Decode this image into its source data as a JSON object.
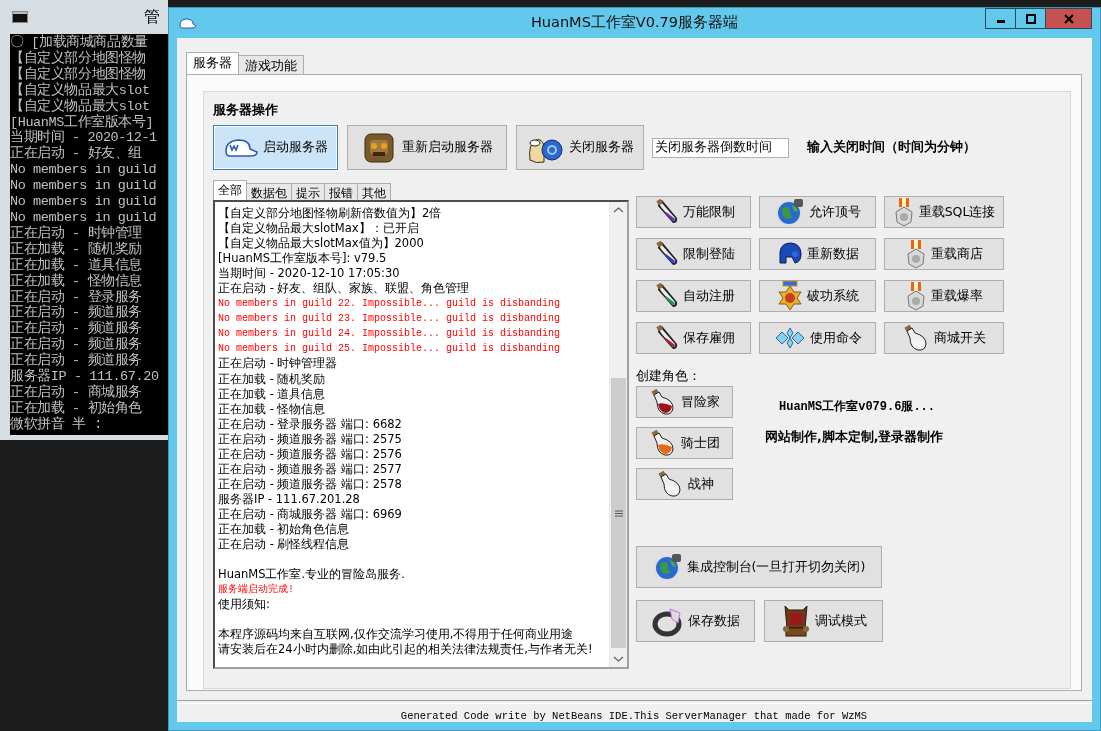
{
  "console": {
    "title": "管",
    "lines": [
      {
        "kind": "text",
        "text": "〇 [加载商城商品数量"
      },
      {
        "kind": "text",
        "text": "【自定义部分地图怪物"
      },
      {
        "kind": "text",
        "text": "【自定义部分地图怪物"
      },
      {
        "kind": "text",
        "text": "【自定义物品最大slot"
      },
      {
        "kind": "text",
        "text": "【自定义物品最大slot"
      },
      {
        "kind": "text",
        "text": "[HuanMS工作室版本号]"
      },
      {
        "kind": "text",
        "text": "当期时间 - 2020-12-1"
      },
      {
        "kind": "text",
        "text": "正在启动 - 好友、组"
      },
      {
        "kind": "text",
        "text": "No members in guild"
      },
      {
        "kind": "text",
        "text": "No members in guild"
      },
      {
        "kind": "text",
        "text": "No members in guild"
      },
      {
        "kind": "text",
        "text": "No members in guild"
      },
      {
        "kind": "text",
        "text": "正在启动 - 时钟管理"
      },
      {
        "kind": "text",
        "text": "正在加载 - 随机奖励"
      },
      {
        "kind": "text",
        "text": "正在加载 - 道具信息"
      },
      {
        "kind": "text",
        "text": "正在加载 - 怪物信息"
      },
      {
        "kind": "text",
        "text": "正在启动 - 登录服务"
      },
      {
        "kind": "text",
        "text": "正在启动 - 频道服务"
      },
      {
        "kind": "text",
        "text": "正在启动 - 频道服务"
      },
      {
        "kind": "text",
        "text": "正在启动 - 频道服务"
      },
      {
        "kind": "text",
        "text": "正在启动 - 频道服务"
      },
      {
        "kind": "text",
        "text": "服务器IP - 111.67.20"
      },
      {
        "kind": "text",
        "text": "正在启动 - 商城服务"
      },
      {
        "kind": "text",
        "text": "正在加载 - 初始角色"
      },
      {
        "kind": "ime",
        "text": "微软拼音 半 :"
      }
    ]
  },
  "window": {
    "title": "HuanMS工作室V0.79服务器端"
  },
  "tabs": [
    {
      "label": "服务器",
      "selected": true
    },
    {
      "label": "游戏功能",
      "selected": false
    }
  ],
  "server_ops": {
    "heading": "服务器操作",
    "buttons": [
      {
        "label": "启动服务器",
        "selected": true
      },
      {
        "label": "重新启动服务器",
        "selected": false
      },
      {
        "label": "关闭服务器",
        "selected": false
      }
    ],
    "countdown_field": {
      "value": "关闭服务器倒数时间"
    },
    "countdown_hint": "输入关闭时间（时间为分钟）"
  },
  "log_tabs": [
    {
      "label": "全部",
      "selected": true
    },
    {
      "label": "数据包",
      "selected": false
    },
    {
      "label": "提示",
      "selected": false
    },
    {
      "label": "报错",
      "selected": false
    },
    {
      "label": "其他",
      "selected": false
    }
  ],
  "log_lines": [
    {
      "kind": "normal",
      "text": "【自定义部分地图怪物刷新倍数值为】2倍"
    },
    {
      "kind": "normal",
      "text": "【自定义物品最大slotMax】：已开启"
    },
    {
      "kind": "normal",
      "text": "【自定义物品最大slotMax值为】2000"
    },
    {
      "kind": "normal",
      "text": "[HuanMS工作室版本号]:  v79.5"
    },
    {
      "kind": "normal",
      "text": "当期时间 - 2020-12-10 17:05:30"
    },
    {
      "kind": "normal",
      "text": "正在启动 - 好友、组队、家族、联盟、角色管理"
    },
    {
      "kind": "error",
      "text": "No members in guild 22.  Impossible... guild is disbanding"
    },
    {
      "kind": "error",
      "text": "No members in guild 23.  Impossible... guild is disbanding"
    },
    {
      "kind": "error",
      "text": "No members in guild 24.  Impossible... guild is disbanding"
    },
    {
      "kind": "error",
      "text": "No members in guild 25.  Impossible... guild is disbanding"
    },
    {
      "kind": "normal",
      "text": "正在启动 - 时钟管理器"
    },
    {
      "kind": "normal",
      "text": "正在加载 - 随机奖励"
    },
    {
      "kind": "normal",
      "text": "正在加载 - 道具信息"
    },
    {
      "kind": "normal",
      "text": "正在加载 - 怪物信息"
    },
    {
      "kind": "normal",
      "text": "正在启动 - 登录服务器 端口: 6682"
    },
    {
      "kind": "normal",
      "text": "正在启动 - 频道服务器 端口: 2575"
    },
    {
      "kind": "normal",
      "text": "正在启动 - 频道服务器 端口: 2576"
    },
    {
      "kind": "normal",
      "text": "正在启动 - 频道服务器 端口: 2577"
    },
    {
      "kind": "normal",
      "text": "正在启动 - 频道服务器 端口: 2578"
    },
    {
      "kind": "normal",
      "text": "服务器IP - 111.67.201.28"
    },
    {
      "kind": "normal",
      "text": "正在启动 - 商城服务器 端口: 6969"
    },
    {
      "kind": "normal",
      "text": "正在加载 - 初始角色信息"
    },
    {
      "kind": "normal",
      "text": "正在启动 - 刷怪线程信息"
    },
    {
      "kind": "gap"
    },
    {
      "kind": "normal",
      "text": "HuanMS工作室.专业的冒险岛服务."
    },
    {
      "kind": "error",
      "text": "服务端启动完成!"
    },
    {
      "kind": "normal",
      "text": "使用须知:"
    },
    {
      "kind": "gap"
    },
    {
      "kind": "normal",
      "text": "本程序源码均来自互联网,仅作交流学习使用,不得用于任何商业用途"
    },
    {
      "kind": "normal",
      "text": "请安装后在24小时内删除,如由此引起的相关法律法规责任,与作者无关!"
    }
  ],
  "function_buttons": [
    "万能限制",
    "允许顶号",
    "重载SQL连接",
    "限制登陆",
    "重新数据",
    "重载商店",
    "自动注册",
    "破功系统",
    "重载爆率",
    "保存雇佣",
    "使用命令",
    "商城开关"
  ],
  "create_heading": "创建角色：",
  "create_buttons": [
    "冒险家",
    "骑士团",
    "战神"
  ],
  "promo": {
    "title": "HuanMS工作室v079.6服...",
    "services": "网站制作,脚本定制,登录器制作"
  },
  "console_button": "集成控制台(一旦打开切勿关闭)",
  "bottom_buttons": [
    "保存数据",
    "调试模式"
  ],
  "footer": "Generated Code write by NetBeans IDE.This ServerManager that made for WzMS"
}
